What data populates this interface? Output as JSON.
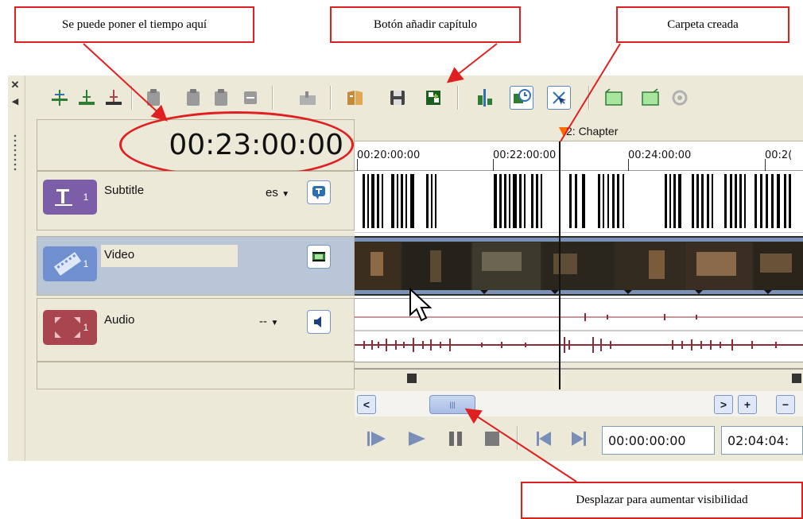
{
  "callouts": {
    "time": "Se puede poner el tiempo aquí",
    "chapter_button": "Botón añadir capítulo",
    "folder": "Carpeta creada",
    "scroll": "Desplazar para aumentar visibilidad"
  },
  "timecode": "00:23:00:00",
  "chapter_marker": "2: Chapter",
  "ruler": {
    "ticks": [
      "00:20:00:00",
      "00:22:00:00",
      "00:24:00:00",
      "00:2("
    ]
  },
  "tracks": [
    {
      "name": "Subtitle",
      "number": "1",
      "language": "es",
      "icon": "subtitle-track-icon",
      "color": "#7b5ea7"
    },
    {
      "name": "Video",
      "number": "1",
      "language": "",
      "icon": "video-track-icon",
      "color": "#6f8fce"
    },
    {
      "name": "Audio",
      "number": "1",
      "language": "--",
      "icon": "audio-track-icon",
      "color": "#a9454f"
    }
  ],
  "transport": {
    "current_time": "00:00:00:00",
    "duration": "02:04:04:"
  },
  "colors": {
    "callout_border": "#e02020",
    "playhead": "#111111",
    "chapter_marker": "#ff6a00"
  }
}
